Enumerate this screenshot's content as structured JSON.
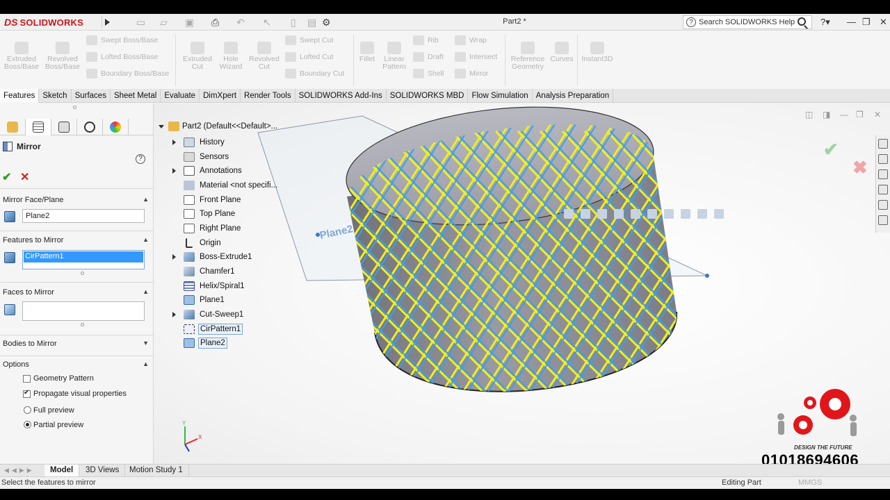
{
  "app": {
    "brand_prefix": "DS",
    "brand_name": "SOLIDWORKS",
    "document_title": "Part2 *",
    "search_placeholder": "Search SOLIDWORKS Help"
  },
  "command_manager": {
    "large": [
      {
        "label": "Extruded\nBoss/Base"
      },
      {
        "label": "Revolved\nBoss/Base"
      },
      {
        "label": "Extruded\nCut"
      },
      {
        "label": "Hole\nWizard"
      },
      {
        "label": "Revolved\nCut"
      },
      {
        "label": "Fillet"
      },
      {
        "label": "Linear\nPattern"
      },
      {
        "label": "Reference\nGeometry"
      },
      {
        "label": "Curves"
      },
      {
        "label": "Instant3D"
      }
    ],
    "small": [
      {
        "label": "Swept Boss/Base"
      },
      {
        "label": "Lofted Boss/Base"
      },
      {
        "label": "Boundary Boss/Base"
      },
      {
        "label": "Swept Cut"
      },
      {
        "label": "Lofted Cut"
      },
      {
        "label": "Boundary Cut"
      },
      {
        "label": "Rib"
      },
      {
        "label": "Draft"
      },
      {
        "label": "Shell"
      },
      {
        "label": "Wrap"
      },
      {
        "label": "Intersect"
      },
      {
        "label": "Mirror"
      }
    ]
  },
  "tabs": [
    "Features",
    "Sketch",
    "Surfaces",
    "Sheet Metal",
    "Evaluate",
    "DimXpert",
    "Render Tools",
    "SOLIDWORKS Add-Ins",
    "SOLIDWORKS MBD",
    "Flow Simulation",
    "Analysis Preparation"
  ],
  "property_manager": {
    "title": "Mirror",
    "mirror_face_plane": {
      "header": "Mirror Face/Plane",
      "value": "Plane2"
    },
    "features_to_mirror": {
      "header": "Features to Mirror",
      "value": "CirPattern1"
    },
    "faces_to_mirror": {
      "header": "Faces to Mirror",
      "value": ""
    },
    "bodies_to_mirror": {
      "header": "Bodies to Mirror"
    },
    "options": {
      "header": "Options",
      "geometry_pattern": {
        "label": "Geometry Pattern",
        "checked": false
      },
      "propagate_visual": {
        "label": "Propagate visual properties",
        "checked": true
      },
      "full_preview": {
        "label": "Full preview",
        "selected": false
      },
      "partial_preview": {
        "label": "Partial preview",
        "selected": true
      }
    }
  },
  "feature_tree": [
    {
      "label": "Part2  (Default<<Default>...",
      "expandable": false,
      "root": true
    },
    {
      "label": "History",
      "expandable": true
    },
    {
      "label": "Sensors",
      "expandable": false
    },
    {
      "label": "Annotations",
      "expandable": true
    },
    {
      "label": "Material <not specifi...",
      "expandable": false
    },
    {
      "label": "Front Plane",
      "expandable": false
    },
    {
      "label": "Top Plane",
      "expandable": false
    },
    {
      "label": "Right Plane",
      "expandable": false
    },
    {
      "label": "Origin",
      "expandable": false
    },
    {
      "label": "Boss-Extrude1",
      "expandable": true
    },
    {
      "label": "Chamfer1",
      "expandable": false
    },
    {
      "label": "Helix/Spiral1",
      "expandable": false
    },
    {
      "label": "Plane1",
      "expandable": false
    },
    {
      "label": "Cut-Sweep1",
      "expandable": true
    },
    {
      "label": "CirPattern1",
      "expandable": false,
      "selected": true
    },
    {
      "label": "Plane2",
      "expandable": false,
      "selected": true
    }
  ],
  "graphics": {
    "plane_label": "Plane2",
    "watermark_tagline": "DESIGN THE FUTURE",
    "phone": "01018694606",
    "colors": {
      "helix_yellow": "#f2ee1c",
      "helix_blue": "#3aa0ea",
      "body_gray": "#8f8f96"
    }
  },
  "bottom_tabs": [
    "Model",
    "3D Views",
    "Motion Study 1"
  ],
  "status_bar": {
    "message": "Select the features to mirror",
    "editing": "Editing Part",
    "units": "MMGS"
  }
}
